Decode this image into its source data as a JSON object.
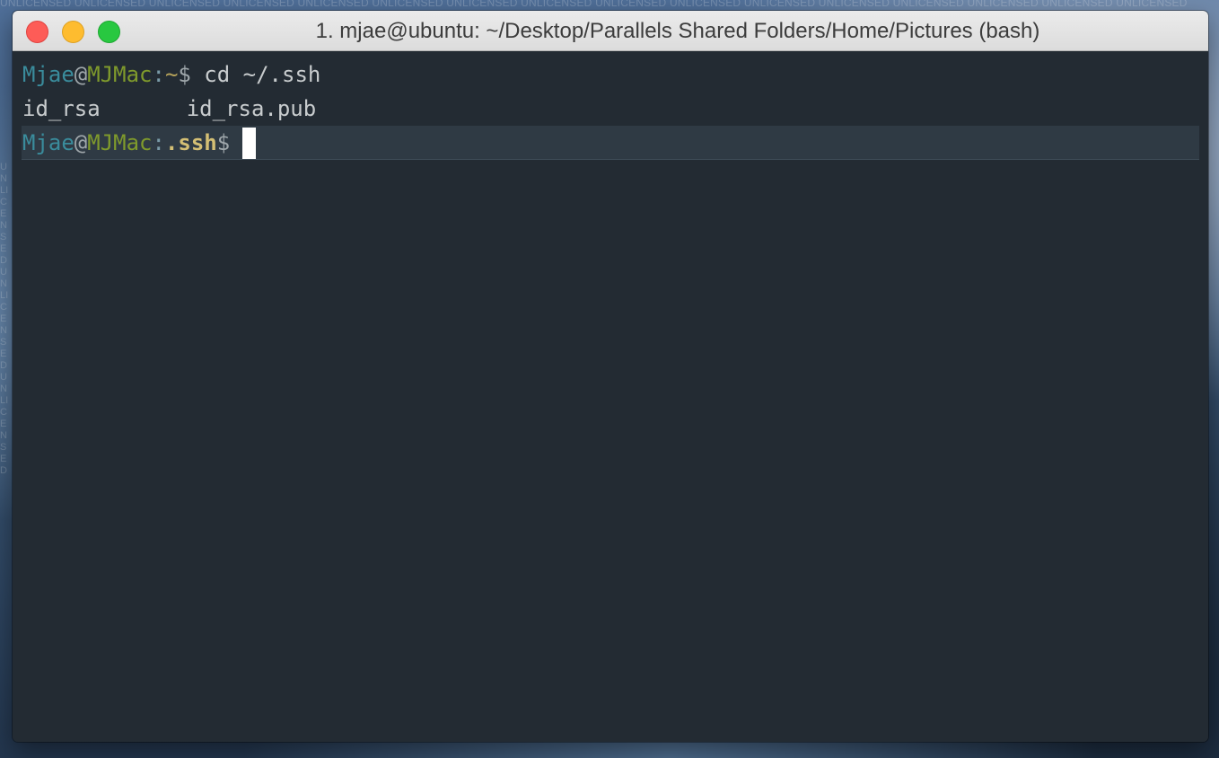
{
  "desktop": {
    "watermark_text": "UNLICENSED UNLICENSED UNLICENSED UNLICENSED UNLICENSED UNLICENSED UNLICENSED UNLICENSED UNLICENSED UNLICENSED UNLICENSED UNLICENSED UNLICENSED UNLICENSED UNLICENSED UNLICENSED",
    "side_watermark_text": "UNLICENSED UNLICENSED UNLICENSED"
  },
  "window": {
    "title": "1. mjae@ubuntu: ~/Desktop/Parallels Shared Folders/Home/Pictures (bash)",
    "controls": {
      "close": "close",
      "minimize": "minimize",
      "zoom": "zoom"
    }
  },
  "terminal": {
    "lines": [
      {
        "user": "Mjae",
        "at": "@",
        "host": "MJMac",
        "colon": ":",
        "cwd": "~",
        "dollar": "$",
        "command": " cd ~/.ssh"
      },
      {
        "files": [
          "id_rsa",
          "id_rsa.pub"
        ]
      },
      {
        "user": "Mjae",
        "at": "@",
        "host": "MJMac",
        "colon": ":",
        "cwd": ".ssh",
        "dollar": "$"
      }
    ]
  },
  "colors": {
    "terminal_background": "#232b33",
    "active_line_background": "#2f3a44",
    "prompt_user": "#3a8c9c",
    "prompt_host": "#7f9a2c",
    "prompt_cwd": "#d4bf74",
    "text": "#c8ccce",
    "cursor": "#ffffff",
    "close_button": "#fd5c57",
    "minimize_button": "#febc2f",
    "zoom_button": "#28c840"
  }
}
